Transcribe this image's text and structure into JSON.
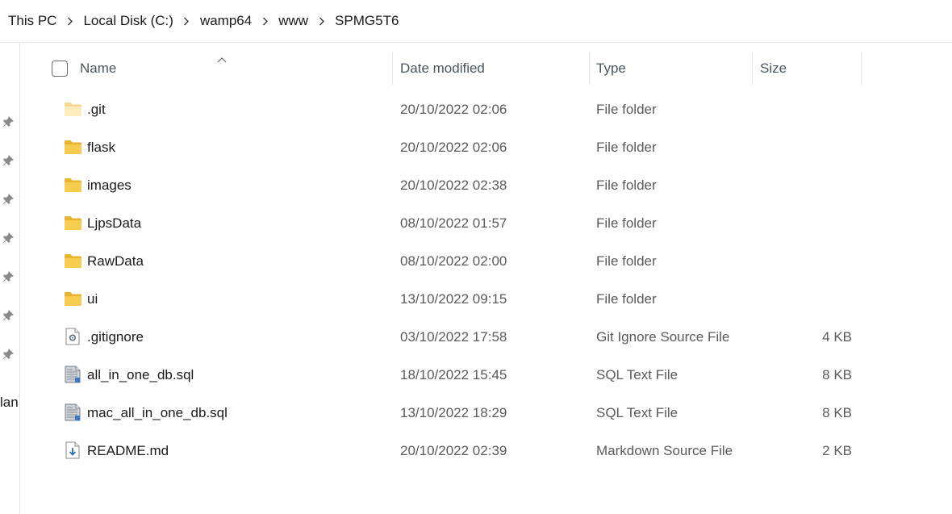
{
  "breadcrumb": [
    "This PC",
    "Local Disk (C:)",
    "wamp64",
    "www",
    "SPMG5T6"
  ],
  "nav": {
    "partial_label": "lan"
  },
  "header": {
    "name": "Name",
    "date": "Date modified",
    "type": "Type",
    "size": "Size"
  },
  "colors": {
    "folder": "#f5c443",
    "folder_light": "#f8e3a6",
    "text_secondary": "#5a5a5a"
  },
  "files": [
    {
      "name": ".git",
      "date": "20/10/2022 02:06",
      "type": "File folder",
      "size": "",
      "icon": "folder-hidden-icon"
    },
    {
      "name": "flask",
      "date": "20/10/2022 02:06",
      "type": "File folder",
      "size": "",
      "icon": "folder-icon"
    },
    {
      "name": "images",
      "date": "20/10/2022 02:38",
      "type": "File folder",
      "size": "",
      "icon": "folder-icon"
    },
    {
      "name": "LjpsData",
      "date": "08/10/2022 01:57",
      "type": "File folder",
      "size": "",
      "icon": "folder-icon"
    },
    {
      "name": "RawData",
      "date": "08/10/2022 02:00",
      "type": "File folder",
      "size": "",
      "icon": "folder-icon"
    },
    {
      "name": "ui",
      "date": "13/10/2022 09:15",
      "type": "File folder",
      "size": "",
      "icon": "folder-icon"
    },
    {
      "name": ".gitignore",
      "date": "03/10/2022 17:58",
      "type": "Git Ignore Source File",
      "size": "4 KB",
      "icon": "config-file-icon"
    },
    {
      "name": "all_in_one_db.sql",
      "date": "18/10/2022 15:45",
      "type": "SQL Text File",
      "size": "8 KB",
      "icon": "sql-file-icon"
    },
    {
      "name": "mac_all_in_one_db.sql",
      "date": "13/10/2022 18:29",
      "type": "SQL Text File",
      "size": "8 KB",
      "icon": "sql-file-icon"
    },
    {
      "name": "README.md",
      "date": "20/10/2022 02:39",
      "type": "Markdown Source File",
      "size": "2 KB",
      "icon": "markdown-file-icon"
    }
  ]
}
